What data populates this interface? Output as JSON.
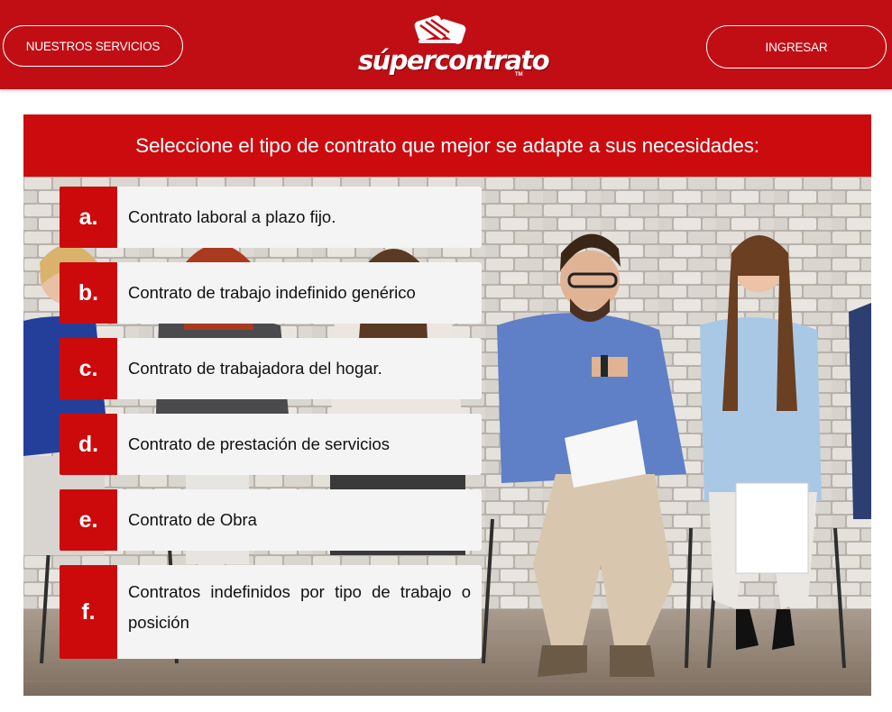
{
  "header": {
    "services_label": "NUESTROS SERVICIOS",
    "login_label": "INGRESAR",
    "logo": {
      "text": "súpercontrato",
      "tm": "TM"
    }
  },
  "main": {
    "title": "Seleccione el tipo de contrato que mejor se adapte a sus necesidades:",
    "options": [
      {
        "letter": "a.",
        "label": "Contrato laboral a plazo fijo."
      },
      {
        "letter": "b.",
        "label": "Contrato de trabajo indefinido genérico"
      },
      {
        "letter": "c.",
        "label": "Contrato de trabajadora del hogar."
      },
      {
        "letter": "d.",
        "label": "Contrato de prestación de servicios"
      },
      {
        "letter": "e.",
        "label": "Contrato de Obra"
      },
      {
        "letter": "f.",
        "label": "Contratos indefinidos por tipo de trabajo o posición"
      }
    ]
  },
  "colors": {
    "brand_red": "#c10e15",
    "letter_red": "#cc0a0c",
    "option_bg": "#f4f4f4"
  }
}
